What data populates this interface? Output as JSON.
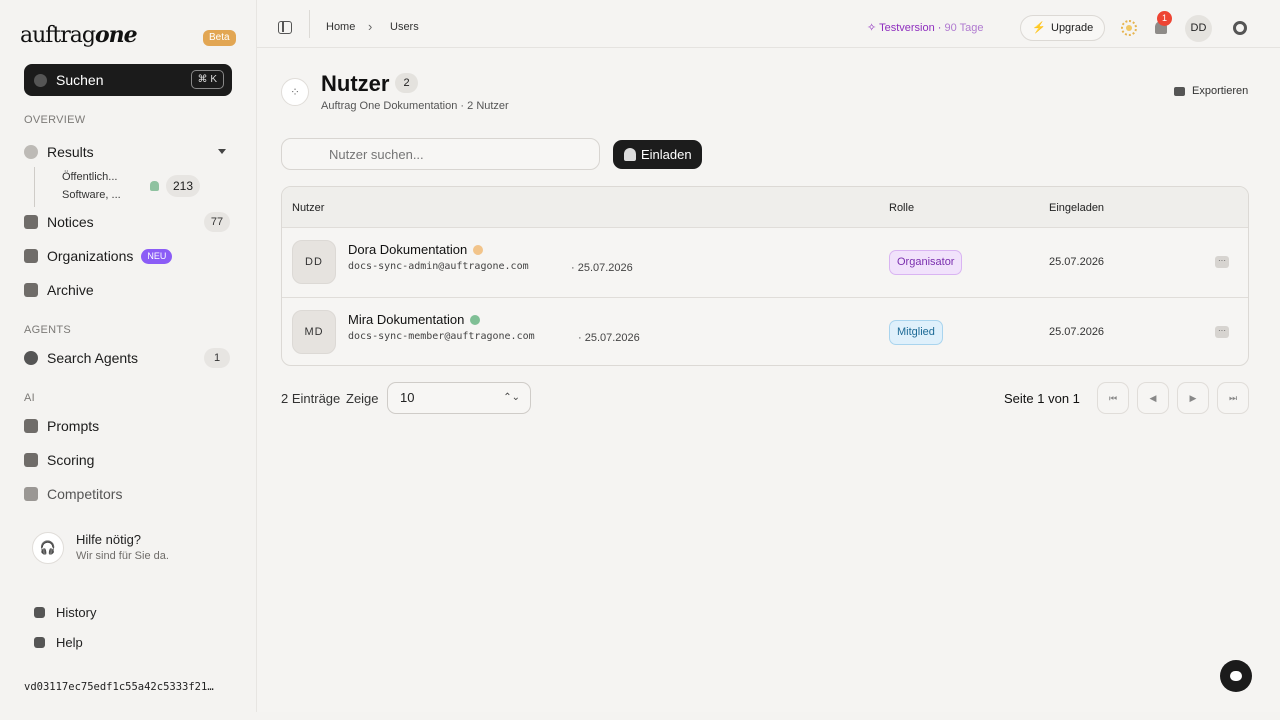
{
  "app": {
    "logo_text": "auftrag",
    "logo_bold": "one",
    "beta_label": "Beta"
  },
  "sidebar": {
    "search_label": "Suchen",
    "search_shortcut": "⌘ K",
    "section_overview": "OVERVIEW",
    "results_label": "Results",
    "results_sub1": "Öffentlich...",
    "results_sub2": "Software, ...",
    "results_count": "213",
    "notices_label": "Notices",
    "notices_count": "77",
    "organizations_label": "Organizations",
    "organizations_badge": "NEU",
    "archive_label": "Archive",
    "section_agents": "AGENTS",
    "search_agents_label": "Search Agents",
    "search_agents_count": "1",
    "section_ai": "AI",
    "prompts_label": "Prompts",
    "scoring_label": "Scoring",
    "competitors_label": "Competitors",
    "help_title": "Hilfe nötig?",
    "help_subtitle": "Wir sind für Sie da.",
    "history_label": "History",
    "help_label": "Help",
    "build_hash": "vd03117ec75edf1c55a42c5333f21…"
  },
  "topbar": {
    "breadcrumb_home": "Home",
    "breadcrumb_current": "Users",
    "trial_label": "Testversion",
    "trial_days": "90 Tage",
    "upgrade_label": "Upgrade",
    "notification_count": "1",
    "user_initials": "DD"
  },
  "page": {
    "title": "Nutzer",
    "title_count": "2",
    "subtitle_org": "Auftrag One Dokumentation",
    "subtitle_count": "2 Nutzer",
    "export_label": "Exportieren",
    "search_placeholder": "Nutzer suchen...",
    "invite_label": "Einladen"
  },
  "table": {
    "col_user": "Nutzer",
    "col_role": "Rolle",
    "col_invited": "Eingeladen",
    "rows": [
      {
        "initials": "DD",
        "name": "Dora Dokumentation",
        "email": "docs-sync-admin@auftragone.com",
        "date_small": "· 25.07.2026",
        "role": "Organisator",
        "invited": "25.07.2026",
        "marker_color": "#f2c48a"
      },
      {
        "initials": "MD",
        "name": "Mira Dokumentation",
        "email": "docs-sync-member@auftragone.com",
        "date_small": "· 25.07.2026",
        "role": "Mitglied",
        "invited": "25.07.2026",
        "marker_color": "#7fbf95"
      }
    ]
  },
  "pagination": {
    "entries_label": "2 Einträge",
    "show_label": "Zeige",
    "page_size": "10",
    "page_info": "Seite 1 von 1"
  }
}
